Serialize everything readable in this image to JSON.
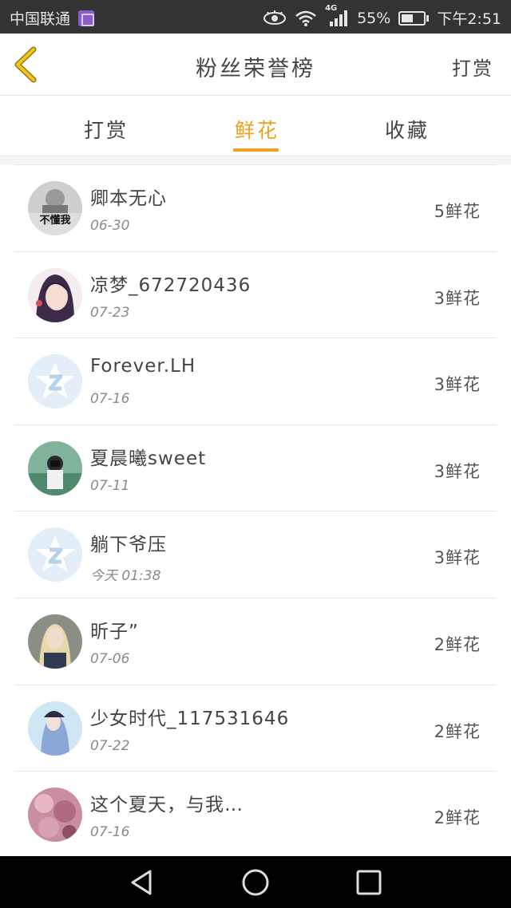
{
  "status_bar": {
    "carrier": "中国联通",
    "network": "4G",
    "battery": "55%",
    "battery_level": 0.55,
    "time": "下午2:51",
    "icons": [
      "app-notification-icon",
      "eye-icon",
      "wifi-icon",
      "signal-icon",
      "battery-icon"
    ]
  },
  "header": {
    "title": "粉丝荣誉榜",
    "action_label": "打赏",
    "back_icon": "chevron-left-icon"
  },
  "tabs": [
    {
      "label": "打赏",
      "active": false
    },
    {
      "label": "鲜花",
      "active": true
    },
    {
      "label": "收藏",
      "active": false
    }
  ],
  "colors": {
    "accent": "#f0a01e",
    "status_bar": "#333333",
    "nav_bar": "#000000"
  },
  "fans": [
    {
      "name": "卿本无心",
      "date": "06-30",
      "count": "5鲜花",
      "avatar": "photo-gray",
      "avatar_text": "不懂我"
    },
    {
      "name": "凉梦_672720436",
      "date": "07-23",
      "count": "3鲜花",
      "avatar": "anime-girl"
    },
    {
      "name": "Forever.LH",
      "date": "07-16",
      "count": "3鲜花",
      "avatar": "default-qzone"
    },
    {
      "name": "夏晨曦sweet",
      "date": "07-11",
      "count": "3鲜花",
      "avatar": "photo-green"
    },
    {
      "name": "躺下爷压",
      "date": "今天 01:38",
      "count": "3鲜花",
      "avatar": "default-qzone"
    },
    {
      "name": "昕子”",
      "date": "07-06",
      "count": "2鲜花",
      "avatar": "photo-blonde"
    },
    {
      "name": "少女时代_117531646",
      "date": "07-22",
      "count": "2鲜花",
      "avatar": "anime-blue"
    },
    {
      "name": "这个夏天，与我…",
      "date": "07-16",
      "count": "2鲜花",
      "avatar": "photo-pink"
    }
  ],
  "nav_bar": [
    "back-triangle-icon",
    "home-circle-icon",
    "recents-square-icon"
  ]
}
